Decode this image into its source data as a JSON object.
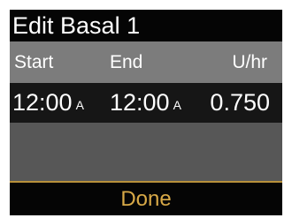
{
  "screen": {
    "title": "Edit Basal 1"
  },
  "table": {
    "headers": {
      "start": "Start",
      "end": "End",
      "rate": "U/hr"
    },
    "rows": [
      {
        "start_time": "12:00",
        "start_ampm": "A",
        "end_time": "12:00",
        "end_ampm": "A",
        "rate": "0.750"
      }
    ]
  },
  "actions": {
    "done_label": "Done"
  },
  "colors": {
    "title_background": "#050505",
    "header_background": "#7c7c7c",
    "selected_row_background": "#161616",
    "empty_background": "#575757",
    "done_text": "#d8a947"
  }
}
